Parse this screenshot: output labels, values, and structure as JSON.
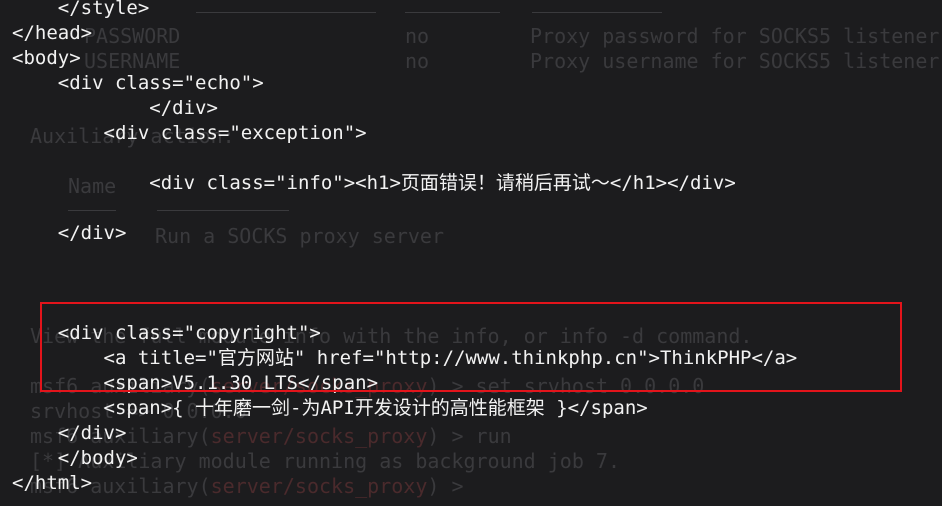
{
  "ghost_background": {
    "lines": [
      "PASSWORD                          no        Proxy password for SOCKS5 listener",
      "USERNAME                          no        Proxy username for SOCKS5 listener",
      "Auxiliary action:",
      "Name    Description",
      "Run a SOCKS proxy server",
      "View the full module info with the info, or info -d command.",
      "msf6 auxiliary(server/socks_proxy) > set srvhost 0.0.0.0",
      "srvhost => 0.0.0.0",
      "msf6 auxiliary(server/socks_proxy) > run",
      "[*] Auxiliary module running as background job 7.",
      "msf6 auxiliary(server/socks_proxy) >"
    ]
  },
  "code_lines": [
    "    </style>",
    "</head>",
    "<body>",
    "    <div class=\"echo\">",
    "            </div>",
    "        <div class=\"exception\">",
    "",
    "            <div class=\"info\"><h1>页面错误！请稍后再试～</h1></div>",
    "",
    "    </div>",
    "",
    "",
    "",
    "    <div class=\"copyright\">",
    "        <a title=\"官方网站\" href=\"http://www.thinkphp.cn\">ThinkPHP</a>",
    "        <span>V5.1.30 LTS</span>",
    "        <span>{ 十年磨一剑-为API开发设计的高性能框架 }</span>",
    "    </div>",
    "    </body>",
    "</html>"
  ],
  "colors": {
    "background": "#1c1c1e",
    "text": "#f2f2f2",
    "ghost_text": "#3a3a3d",
    "highlight_border": "#e3141b"
  }
}
